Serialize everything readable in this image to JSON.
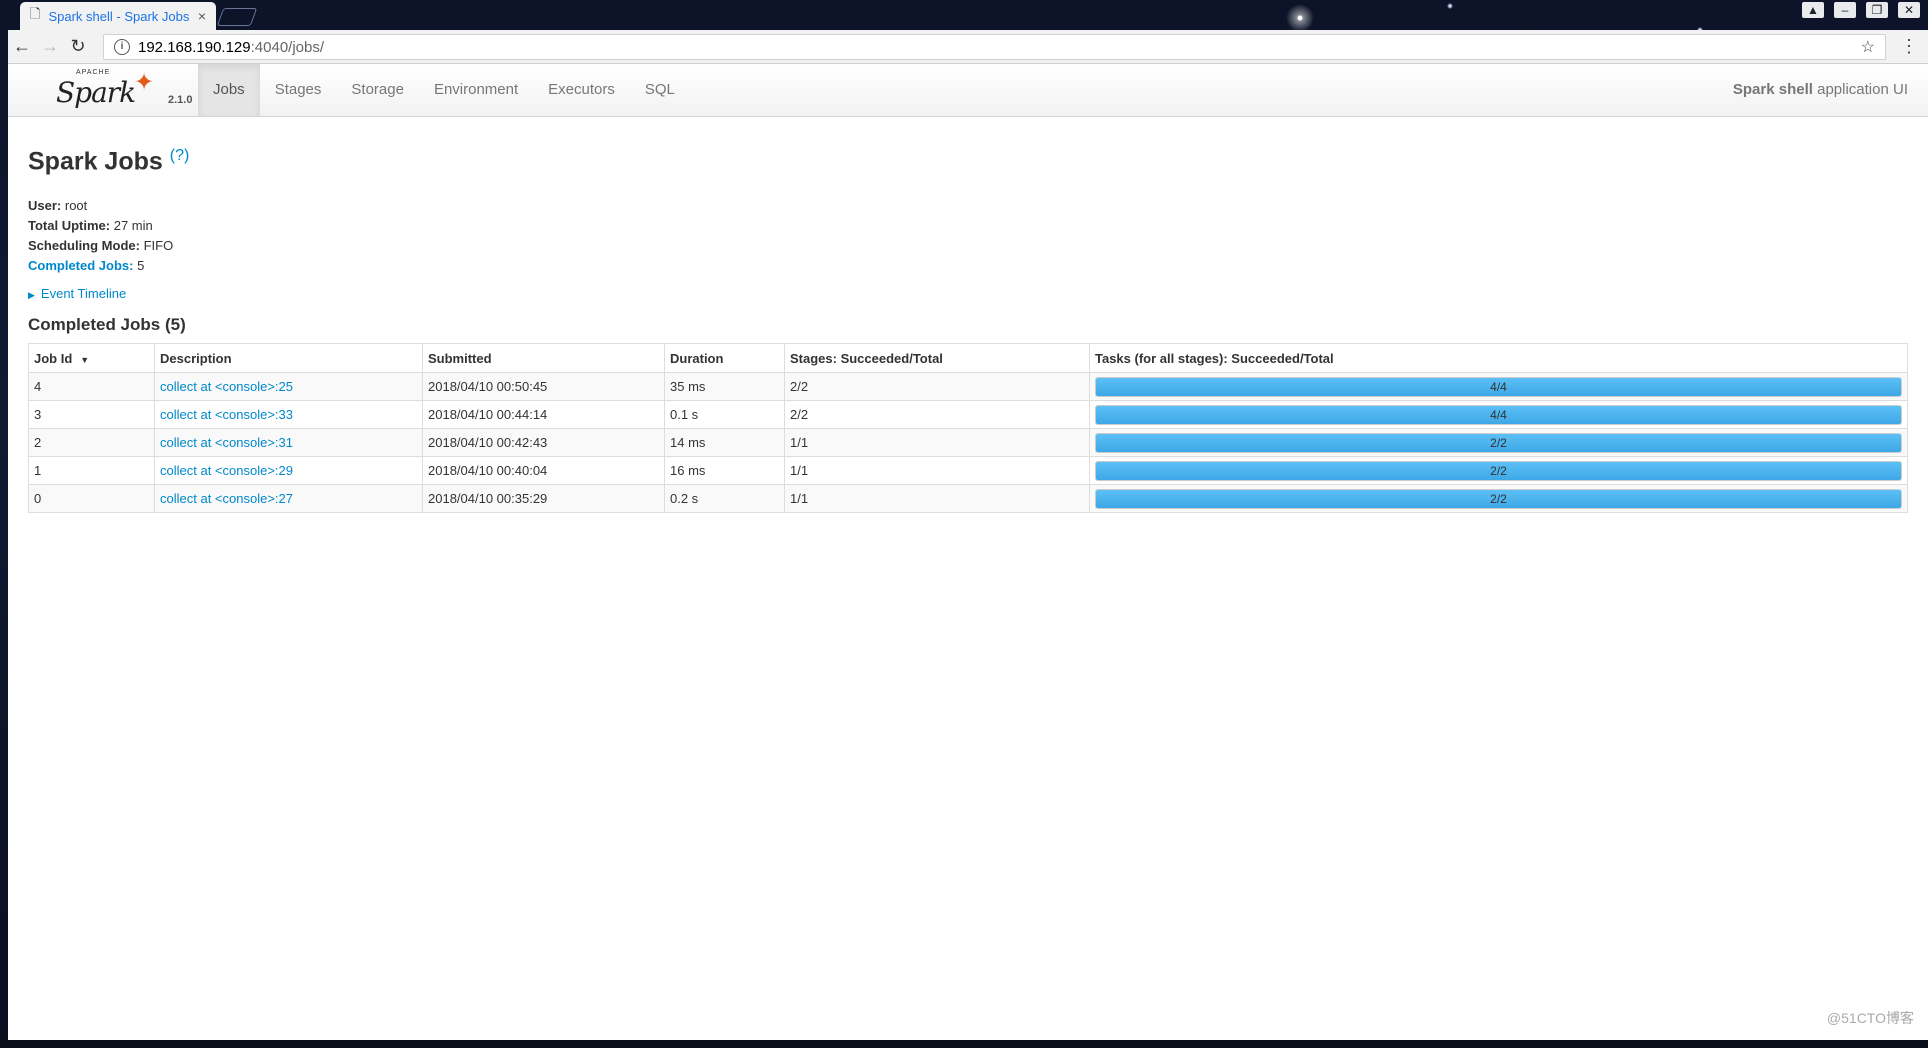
{
  "browser": {
    "tab_title": "Spark shell - Spark Jobs",
    "tab_close": "×",
    "url_host": "192.168.190.129",
    "url_port_path": ":4040/jobs/",
    "back_icon": "arrow-left-icon",
    "forward_icon": "arrow-right-icon",
    "reload_icon": "reload-icon",
    "info_icon": "info-icon",
    "star_icon": "star-icon",
    "menu_icon": "kebab-menu-icon"
  },
  "navbar": {
    "logo_top": "APACHE",
    "logo_text": "Spark",
    "version": "2.1.0",
    "tabs": [
      {
        "label": "Jobs",
        "active": true
      },
      {
        "label": "Stages",
        "active": false
      },
      {
        "label": "Storage",
        "active": false
      },
      {
        "label": "Environment",
        "active": false
      },
      {
        "label": "Executors",
        "active": false
      },
      {
        "label": "SQL",
        "active": false
      }
    ],
    "app_name_bold": "Spark shell",
    "app_name_rest": " application UI"
  },
  "page": {
    "title": "Spark Jobs",
    "help": "(?)",
    "summary": {
      "user_label": "User:",
      "user_value": "root",
      "uptime_label": "Total Uptime:",
      "uptime_value": "27 min",
      "mode_label": "Scheduling Mode:",
      "mode_value": "FIFO",
      "completed_label": "Completed Jobs:",
      "completed_value": "5"
    },
    "event_timeline": "Event Timeline",
    "completed_heading": "Completed Jobs (5)"
  },
  "table": {
    "headers": [
      "Job Id",
      "Description",
      "Submitted",
      "Duration",
      "Stages: Succeeded/Total",
      "Tasks (for all stages): Succeeded/Total"
    ],
    "sort_indicator": "▼",
    "rows": [
      {
        "id": "4",
        "desc": "collect at <console>:25",
        "submitted": "2018/04/10 00:50:45",
        "duration": "35 ms",
        "stages": "2/2",
        "tasks": "4/4",
        "task_fraction": 1.0
      },
      {
        "id": "3",
        "desc": "collect at <console>:33",
        "submitted": "2018/04/10 00:44:14",
        "duration": "0.1 s",
        "stages": "2/2",
        "tasks": "4/4",
        "task_fraction": 1.0
      },
      {
        "id": "2",
        "desc": "collect at <console>:31",
        "submitted": "2018/04/10 00:42:43",
        "duration": "14 ms",
        "stages": "1/1",
        "tasks": "2/2",
        "task_fraction": 1.0
      },
      {
        "id": "1",
        "desc": "collect at <console>:29",
        "submitted": "2018/04/10 00:40:04",
        "duration": "16 ms",
        "stages": "1/1",
        "tasks": "2/2",
        "task_fraction": 1.0
      },
      {
        "id": "0",
        "desc": "collect at <console>:27",
        "submitted": "2018/04/10 00:35:29",
        "duration": "0.2 s",
        "stages": "1/1",
        "tasks": "2/2",
        "task_fraction": 1.0
      }
    ]
  },
  "watermark": "@51CTO博客",
  "colors": {
    "link": "#0088cc",
    "progress": "#3ea7e6",
    "spark_orange": "#e25a1c"
  }
}
